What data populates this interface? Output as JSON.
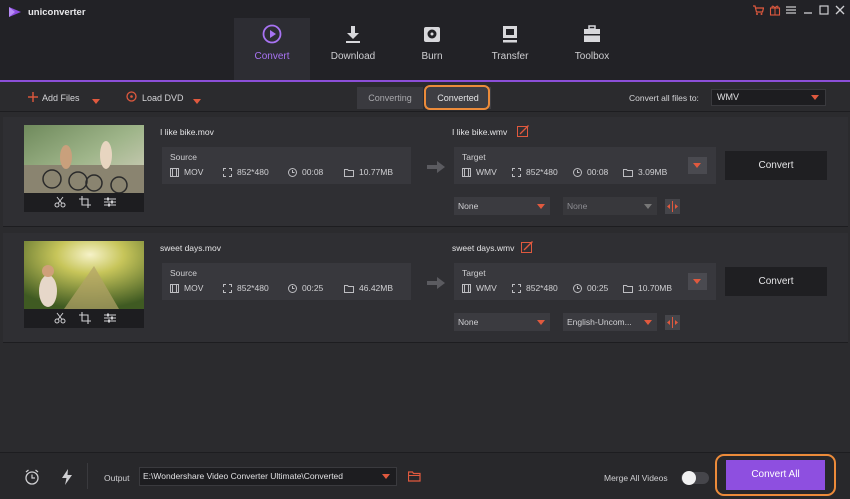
{
  "app": {
    "title": "uniconverter"
  },
  "colors": {
    "accent": "#8e4fe0",
    "highlight": "#ec8b3a",
    "caret": "#e0593e"
  },
  "window_controls": [
    "cart-icon",
    "gift-icon",
    "menu-icon",
    "minimize-icon",
    "maximize-icon",
    "close-icon"
  ],
  "nav": {
    "tabs": [
      {
        "label": "Convert",
        "icon": "convert-icon",
        "active": true
      },
      {
        "label": "Download",
        "icon": "download-icon",
        "active": false
      },
      {
        "label": "Burn",
        "icon": "burn-icon",
        "active": false
      },
      {
        "label": "Transfer",
        "icon": "transfer-icon",
        "active": false
      },
      {
        "label": "Toolbox",
        "icon": "toolbox-icon",
        "active": false
      }
    ]
  },
  "toolbar": {
    "add_files": "Add Files",
    "load_dvd": "Load DVD",
    "converting": "Converting",
    "converted": "Converted",
    "convert_all_label": "Convert all files to:",
    "convert_all_format": "WMV"
  },
  "files": [
    {
      "source_name": "I like bike.mov",
      "target_name": "I like bike.wmv",
      "source": {
        "title": "Source",
        "format": "MOV",
        "resolution": "852*480",
        "duration": "00:08",
        "size": "10.77MB"
      },
      "target": {
        "title": "Target",
        "format": "WMV",
        "resolution": "852*480",
        "duration": "00:08",
        "size": "3.09MB"
      },
      "subtitle": "None",
      "audio": "None",
      "convert_label": "Convert"
    },
    {
      "source_name": "sweet days.mov",
      "target_name": "sweet days.wmv",
      "source": {
        "title": "Source",
        "format": "MOV",
        "resolution": "852*480",
        "duration": "00:25",
        "size": "46.42MB"
      },
      "target": {
        "title": "Target",
        "format": "WMV",
        "resolution": "852*480",
        "duration": "00:25",
        "size": "10.70MB"
      },
      "subtitle": "None",
      "audio": "English-Uncom...",
      "convert_label": "Convert"
    }
  ],
  "bottom": {
    "output_label": "Output",
    "output_path": "E:\\Wondershare Video Converter Ultimate\\Converted",
    "merge_label": "Merge All Videos",
    "merge_on": false,
    "convert_all": "Convert All"
  }
}
